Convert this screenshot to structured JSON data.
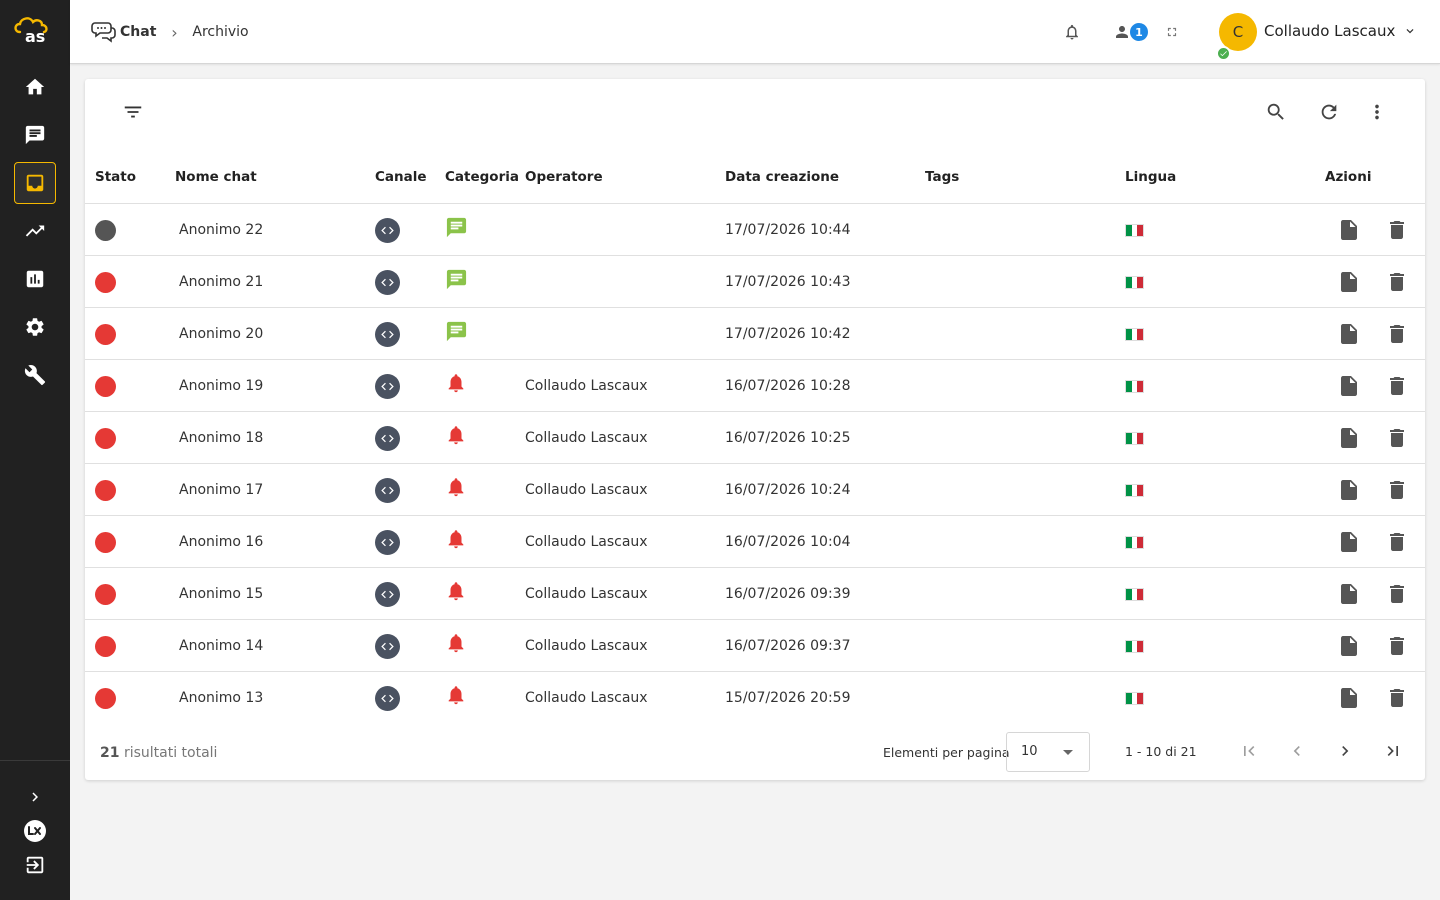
{
  "brand": {
    "logo_text": "as",
    "accent_color": "#f5b800"
  },
  "sidebar": {
    "items": [
      {
        "icon": "home-icon",
        "active": false
      },
      {
        "icon": "chat-icon",
        "active": false
      },
      {
        "icon": "inbox-icon",
        "active": true
      },
      {
        "icon": "trending-icon",
        "active": false
      },
      {
        "icon": "bar-chart-icon",
        "active": false
      },
      {
        "icon": "gear-icon",
        "active": false
      },
      {
        "icon": "wrench-icon",
        "active": false
      }
    ],
    "bottom": [
      {
        "icon": "chevron-right-icon"
      },
      {
        "icon": "lx-brand-icon"
      },
      {
        "icon": "logout-icon"
      }
    ]
  },
  "header": {
    "breadcrumb": {
      "section": "Chat",
      "current": "Archivio"
    },
    "notifications_icon": "bell-icon",
    "users_icon": "person-icon",
    "users_count": "1",
    "fullscreen_icon": "fullscreen-icon",
    "user": {
      "initial": "C",
      "name": "Collaudo Lascaux",
      "online": true
    }
  },
  "toolbar": {
    "filter_icon": "filter-icon",
    "search_icon": "search-icon",
    "refresh_icon": "refresh-icon",
    "more_icon": "more-vert-icon"
  },
  "table": {
    "headers": {
      "stato": "Stato",
      "nome": "Nome chat",
      "canale": "Canale",
      "categoria": "Categoria",
      "operatore": "Operatore",
      "data": "Data creazione",
      "tags": "Tags",
      "lingua": "Lingua",
      "azioni": "Azioni"
    },
    "rows": [
      {
        "status": "closed",
        "status_color": "#555555",
        "name": "Anonimo 22",
        "category": "message",
        "operator": "",
        "date": "17/07/2026 10:44",
        "lang": "it"
      },
      {
        "status": "waiting",
        "status_color": "#e53935",
        "name": "Anonimo 21",
        "category": "message",
        "operator": "",
        "date": "17/07/2026 10:43",
        "lang": "it"
      },
      {
        "status": "waiting",
        "status_color": "#e53935",
        "name": "Anonimo 20",
        "category": "message",
        "operator": "",
        "date": "17/07/2026 10:42",
        "lang": "it"
      },
      {
        "status": "waiting",
        "status_color": "#e53935",
        "name": "Anonimo 19",
        "category": "alert",
        "operator": "Collaudo Lascaux",
        "date": "16/07/2026 10:28",
        "lang": "it"
      },
      {
        "status": "waiting",
        "status_color": "#e53935",
        "name": "Anonimo 18",
        "category": "alert",
        "operator": "Collaudo Lascaux",
        "date": "16/07/2026 10:25",
        "lang": "it"
      },
      {
        "status": "waiting",
        "status_color": "#e53935",
        "name": "Anonimo 17",
        "category": "alert",
        "operator": "Collaudo Lascaux",
        "date": "16/07/2026 10:24",
        "lang": "it"
      },
      {
        "status": "waiting",
        "status_color": "#e53935",
        "name": "Anonimo 16",
        "category": "alert",
        "operator": "Collaudo Lascaux",
        "date": "16/07/2026 10:04",
        "lang": "it"
      },
      {
        "status": "waiting",
        "status_color": "#e53935",
        "name": "Anonimo 15",
        "category": "alert",
        "operator": "Collaudo Lascaux",
        "date": "16/07/2026 09:39",
        "lang": "it"
      },
      {
        "status": "waiting",
        "status_color": "#e53935",
        "name": "Anonimo 14",
        "category": "alert",
        "operator": "Collaudo Lascaux",
        "date": "16/07/2026 09:37",
        "lang": "it"
      },
      {
        "status": "waiting",
        "status_color": "#e53935",
        "name": "Anonimo 13",
        "category": "alert",
        "operator": "Collaudo Lascaux",
        "date": "15/07/2026 20:59",
        "lang": "it"
      }
    ],
    "colors": {
      "message": "#8bc34a",
      "alert": "#e53935",
      "channel": "#4a5261",
      "action": "#555555"
    }
  },
  "footer": {
    "total_count": "21",
    "total_label": "risultati totali",
    "per_page_label": "Elementi per pagina",
    "per_page_value": "10",
    "range": "1 - 10 di 21"
  }
}
